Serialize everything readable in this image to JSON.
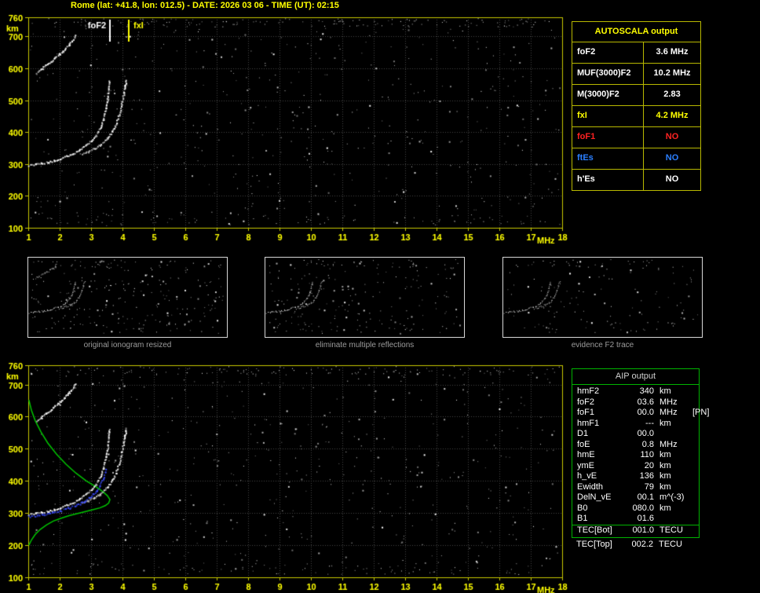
{
  "header": {
    "title": "Rome (lat: +41.8, lon: 012.5) - DATE: 2026 03 06 - TIME (UT): 02:15"
  },
  "colors": {
    "background": "#000000",
    "title_yellow": "#ffff00",
    "axis_yellow": "#c8c800",
    "tick_label_yellow": "#ffff00",
    "grid_gray": "#454545",
    "autoscala_border": "#b8b800",
    "aip_border": "#00b400",
    "trace_white": "#ffffff",
    "profile_green": "#00c400",
    "fitted_blue": "#3a4bff",
    "caption_gray": "#9c9c9c",
    "value_red": "#ff2222",
    "value_blue": "#2b7fff"
  },
  "autoscala": {
    "title": "AUTOSCALA output",
    "rows": [
      {
        "label": "foF2",
        "value": "3.6 MHz",
        "color": "#ffffff"
      },
      {
        "label": "MUF(3000)F2",
        "value": "10.2 MHz",
        "color": "#ffffff"
      },
      {
        "label": "M(3000)F2",
        "value": "2.83",
        "color": "#ffffff"
      },
      {
        "label": "fxI",
        "value": "4.2 MHz",
        "color": "#ffff00"
      },
      {
        "label": "foF1",
        "value": "NO",
        "color": "#ff2222"
      },
      {
        "label": "ftEs",
        "value": "NO",
        "color": "#2b7fff"
      },
      {
        "label": "h'Es",
        "value": "NO",
        "color": "#ffffff"
      }
    ]
  },
  "thumbnails": [
    {
      "caption": "original ionogram resized",
      "show_second_hop": true,
      "noise_count": 230,
      "trace_alpha": 1
    },
    {
      "caption": "eliminate multiple reflections",
      "show_second_hop": false,
      "noise_count": 180,
      "trace_alpha": 1
    },
    {
      "caption": "evidence F2 trace",
      "show_second_hop": false,
      "noise_count": 110,
      "trace_alpha": 0.9
    }
  ],
  "aip": {
    "title": "AIP output",
    "rows": [
      {
        "label": "hmF2",
        "value": "340",
        "unit": "km",
        "extra": ""
      },
      {
        "label": "foF2",
        "value": "03.6",
        "unit": "MHz",
        "extra": ""
      },
      {
        "label": "foF1",
        "value": "00.0",
        "unit": "MHz",
        "extra": "[PN]"
      },
      {
        "label": "hmF1",
        "value": "---",
        "unit": "km",
        "extra": ""
      },
      {
        "label": "D1",
        "value": "00.0",
        "unit": "",
        "extra": ""
      },
      {
        "label": "foE",
        "value": "0.8",
        "unit": "MHz",
        "extra": ""
      },
      {
        "label": "hmE",
        "value": "110",
        "unit": "km",
        "extra": ""
      },
      {
        "label": "ymE",
        "value": "20",
        "unit": "km",
        "extra": ""
      },
      {
        "label": "h_vE",
        "value": "136",
        "unit": "km",
        "extra": ""
      },
      {
        "label": "Ewidth",
        "value": "79",
        "unit": "km",
        "extra": ""
      },
      {
        "label": "DelN_vE",
        "value": "00.1",
        "unit": "m^(-3)",
        "extra": ""
      },
      {
        "label": "B0",
        "value": "080.0",
        "unit": "km",
        "extra": ""
      },
      {
        "label": "B1",
        "value": "01.6",
        "unit": "",
        "extra": ""
      },
      {
        "label": "TEC[Bot]",
        "value": "001.0",
        "unit": "TECU",
        "extra": "",
        "sep_before": true
      },
      {
        "label": "TEC[Top]",
        "value": "002.2",
        "unit": "TECU",
        "extra": "",
        "outside": true
      }
    ]
  },
  "chart_data": [
    {
      "id": "top-ionogram",
      "type": "scatter",
      "title": "recorded ionogram",
      "xlabel": "MHz",
      "ylabel": "km",
      "xlim": [
        1,
        18
      ],
      "ylim": [
        100,
        760
      ],
      "x_ticks": [
        1,
        2,
        3,
        4,
        5,
        6,
        7,
        8,
        9,
        10,
        11,
        12,
        13,
        14,
        15,
        16,
        17,
        18
      ],
      "y_ticks": [
        100,
        200,
        300,
        400,
        500,
        600,
        700,
        760
      ],
      "grid": true,
      "legend": "none",
      "markers": [
        {
          "label": "foF2",
          "freq": 3.6,
          "color": "#ffffff",
          "label_side": "left"
        },
        {
          "label": "fxI",
          "freq": 4.2,
          "color": "#ffff00",
          "label_side": "right"
        }
      ],
      "noise": {
        "seed": 11,
        "count": 540,
        "top_band": 130,
        "bottom_band": 60
      },
      "series": [
        {
          "name": "F2-ordinary-trace",
          "color": "#ffffff",
          "style": "dots",
          "points": [
            [
              1.0,
              298
            ],
            [
              1.2,
              300
            ],
            [
              1.4,
              303
            ],
            [
              1.6,
              307
            ],
            [
              1.8,
              312
            ],
            [
              2.0,
              318
            ],
            [
              2.2,
              325
            ],
            [
              2.4,
              334
            ],
            [
              2.6,
              344
            ],
            [
              2.8,
              357
            ],
            [
              3.0,
              373
            ],
            [
              3.15,
              392
            ],
            [
              3.28,
              415
            ],
            [
              3.38,
              442
            ],
            [
              3.46,
              475
            ],
            [
              3.52,
              512
            ],
            [
              3.55,
              545
            ],
            [
              3.57,
              562
            ]
          ]
        },
        {
          "name": "F2-extraordinary-trace",
          "color": "#ffffff",
          "style": "dots",
          "points": [
            [
              2.7,
              332
            ],
            [
              2.9,
              340
            ],
            [
              3.1,
              350
            ],
            [
              3.3,
              363
            ],
            [
              3.5,
              381
            ],
            [
              3.65,
              402
            ],
            [
              3.78,
              427
            ],
            [
              3.88,
              456
            ],
            [
              3.96,
              490
            ],
            [
              4.03,
              524
            ],
            [
              4.08,
              552
            ],
            [
              4.1,
              565
            ]
          ]
        },
        {
          "name": "second-hop-echo",
          "color": "#ffffff",
          "style": "dots",
          "points": [
            [
              1.25,
              585
            ],
            [
              1.4,
              598
            ],
            [
              1.55,
              610
            ],
            [
              1.7,
              622
            ],
            [
              1.85,
              634
            ],
            [
              2.0,
              647
            ],
            [
              2.15,
              661
            ],
            [
              2.3,
              677
            ],
            [
              2.42,
              692
            ],
            [
              2.5,
              705
            ]
          ]
        }
      ]
    },
    {
      "id": "bottom-ionogram",
      "type": "scatter",
      "title": "ionogram with restored electron density profile",
      "xlabel": "MHz",
      "ylabel": "km",
      "xlim": [
        1,
        18
      ],
      "ylim": [
        100,
        760
      ],
      "x_ticks": [
        1,
        2,
        3,
        4,
        5,
        6,
        7,
        8,
        9,
        10,
        11,
        12,
        13,
        14,
        15,
        16,
        17,
        18
      ],
      "y_ticks": [
        100,
        200,
        300,
        400,
        500,
        600,
        700,
        760
      ],
      "grid": true,
      "legend": "none",
      "markers": [],
      "noise": {
        "seed": 77,
        "count": 520,
        "top_band": 120,
        "bottom_band": 70
      },
      "series": [
        {
          "name": "electron-density-profile",
          "color": "#00c400",
          "style": "line",
          "points": [
            [
              1.02,
              652
            ],
            [
              1.1,
              620
            ],
            [
              1.22,
              588
            ],
            [
              1.4,
              553
            ],
            [
              1.62,
              518
            ],
            [
              1.9,
              483
            ],
            [
              2.2,
              452
            ],
            [
              2.52,
              424
            ],
            [
              2.85,
              400
            ],
            [
              3.15,
              382
            ],
            [
              3.38,
              366
            ],
            [
              3.52,
              354
            ],
            [
              3.6,
              342
            ],
            [
              3.56,
              331
            ],
            [
              3.45,
              323
            ],
            [
              3.28,
              316
            ],
            [
              3.05,
              310
            ],
            [
              2.8,
              304
            ],
            [
              2.55,
              298
            ],
            [
              2.3,
              292
            ],
            [
              2.05,
              284
            ],
            [
              1.8,
              275
            ],
            [
              1.58,
              263
            ],
            [
              1.38,
              249
            ],
            [
              1.22,
              233
            ],
            [
              1.1,
              216
            ],
            [
              1.02,
              200
            ]
          ]
        },
        {
          "name": "F2-ordinary-trace",
          "color": "#ffffff",
          "style": "dots",
          "points": [
            [
              1.0,
              298
            ],
            [
              1.2,
              300
            ],
            [
              1.4,
              303
            ],
            [
              1.6,
              307
            ],
            [
              1.8,
              312
            ],
            [
              2.0,
              318
            ],
            [
              2.2,
              325
            ],
            [
              2.4,
              334
            ],
            [
              2.6,
              344
            ],
            [
              2.8,
              357
            ],
            [
              3.0,
              373
            ],
            [
              3.15,
              392
            ],
            [
              3.28,
              415
            ],
            [
              3.38,
              442
            ],
            [
              3.46,
              475
            ],
            [
              3.52,
              512
            ],
            [
              3.55,
              545
            ],
            [
              3.57,
              562
            ]
          ]
        },
        {
          "name": "F2-extraordinary-trace",
          "color": "#ffffff",
          "style": "dots",
          "points": [
            [
              2.7,
              332
            ],
            [
              2.9,
              340
            ],
            [
              3.1,
              350
            ],
            [
              3.3,
              363
            ],
            [
              3.5,
              381
            ],
            [
              3.65,
              402
            ],
            [
              3.78,
              427
            ],
            [
              3.88,
              456
            ],
            [
              3.96,
              490
            ],
            [
              4.03,
              524
            ],
            [
              4.08,
              552
            ],
            [
              4.1,
              565
            ]
          ]
        },
        {
          "name": "second-hop-echo",
          "color": "#ffffff",
          "style": "dots",
          "points": [
            [
              1.25,
              585
            ],
            [
              1.4,
              598
            ],
            [
              1.55,
              610
            ],
            [
              1.7,
              622
            ],
            [
              1.85,
              634
            ],
            [
              2.0,
              647
            ],
            [
              2.15,
              661
            ],
            [
              2.3,
              677
            ],
            [
              2.42,
              692
            ],
            [
              2.5,
              705
            ]
          ]
        },
        {
          "name": "autoscala-fitted-trace",
          "color": "#3a4bff",
          "style": "dots",
          "points": [
            [
              1.0,
              291
            ],
            [
              1.25,
              294
            ],
            [
              1.5,
              298
            ],
            [
              1.75,
              303
            ],
            [
              2.0,
              309
            ],
            [
              2.25,
              316
            ],
            [
              2.5,
              325
            ],
            [
              2.75,
              337
            ],
            [
              2.95,
              350
            ],
            [
              3.12,
              366
            ],
            [
              3.27,
              386
            ],
            [
              3.38,
              410
            ],
            [
              3.45,
              436
            ]
          ]
        }
      ]
    }
  ]
}
